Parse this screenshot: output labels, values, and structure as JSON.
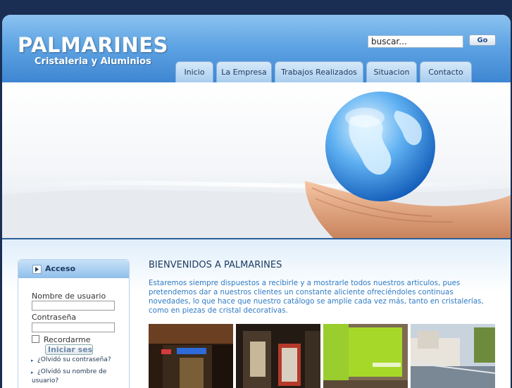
{
  "header": {
    "title": "PALMARINES",
    "subtitle": "Cristaleria y Aluminios",
    "search": {
      "value": "buscar...",
      "button": "Go"
    }
  },
  "nav": {
    "tabs": [
      {
        "label": "Inicio"
      },
      {
        "label": "La Empresa"
      },
      {
        "label": "Trabajos Realizados"
      },
      {
        "label": "Situacion"
      },
      {
        "label": "Contacto"
      }
    ]
  },
  "login": {
    "title": "Acceso",
    "username_label": "Nombre de usuario",
    "password_label": "Contraseña",
    "remember_label": "Recordarme",
    "submit": "Iniciar sesión",
    "forgot_password": "¿Olvidó su contraseña?",
    "forgot_username": "¿Olvidó su nombre de usuario?"
  },
  "main": {
    "heading": "BIENVENIDOS A PALMARINES",
    "intro": "Estaremos siempre dispuestos a recibirle y a mostrarle todos nuestros articulos, pues pretendemos dar a nuestros clientes un constante aliciente ofreciéndoles continuas novedades, lo que hace que nuestro catálogo se amplíe cada vez más, tanto en cristalerías, como en piezas de cristal decorativas."
  },
  "colors": {
    "header_blue": "#4a90d9",
    "page_background": "#1a2d52",
    "heading_text": "#1e3b63",
    "intro_text": "#2f7bc4"
  }
}
